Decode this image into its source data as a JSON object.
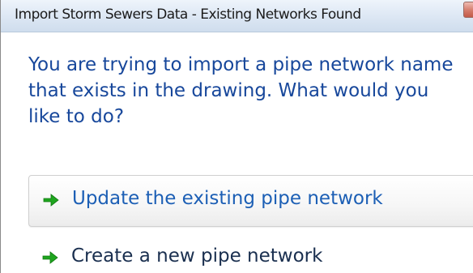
{
  "dialog": {
    "title": "Import Storm Sewers Data - Existing Networks Found",
    "instruction": "You are trying to import a pipe network name that exists in the drawing.  What would you like to do?",
    "options": [
      {
        "label": "Update the existing pipe network",
        "icon": "green-arrow-icon"
      },
      {
        "label": "Create a new pipe network",
        "icon": "green-arrow-icon"
      }
    ]
  },
  "colors": {
    "instruction_text": "#17479b",
    "arrow_green": "#1ea51e",
    "hover_link_text": "#1c5fb5"
  }
}
